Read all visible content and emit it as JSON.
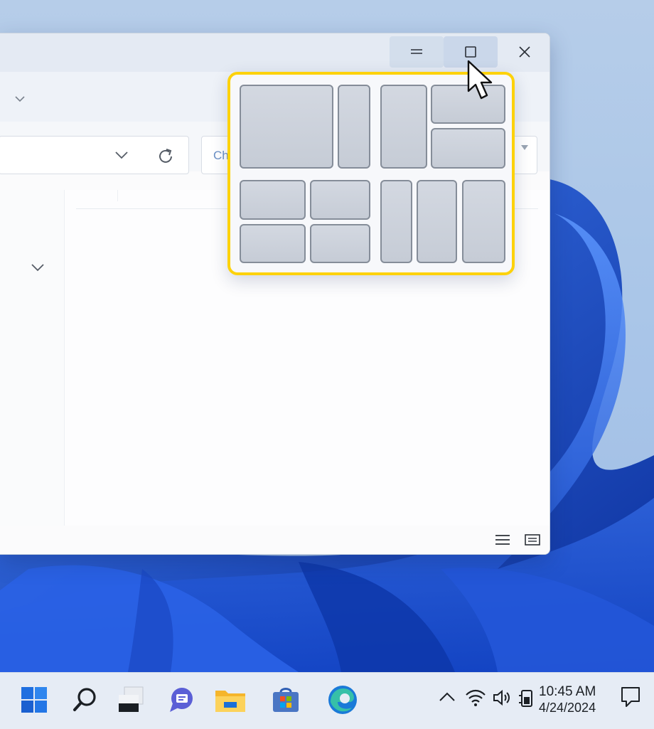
{
  "window": {
    "search_placeholder": "Ch"
  },
  "snap_layouts": {
    "highlight_color": "#fdd20b",
    "layouts": [
      "two-column-wide-narrow",
      "main-plus-two-stacked",
      "four-quadrant",
      "three-column"
    ]
  },
  "taskbar": {
    "apps": [
      "start-icon",
      "search-icon",
      "task-view-icon",
      "chat-icon",
      "file-explorer-icon",
      "microsoft-store-icon",
      "edge-icon"
    ],
    "tray": [
      "chevron-up-icon",
      "wifi-icon",
      "volume-icon",
      "battery-icon"
    ],
    "time": "10:45 AM",
    "date": "4/24/2024"
  },
  "colors": {
    "accent_blue": "#1f5fe0",
    "wallpaper_dark": "#0b3bb5"
  }
}
